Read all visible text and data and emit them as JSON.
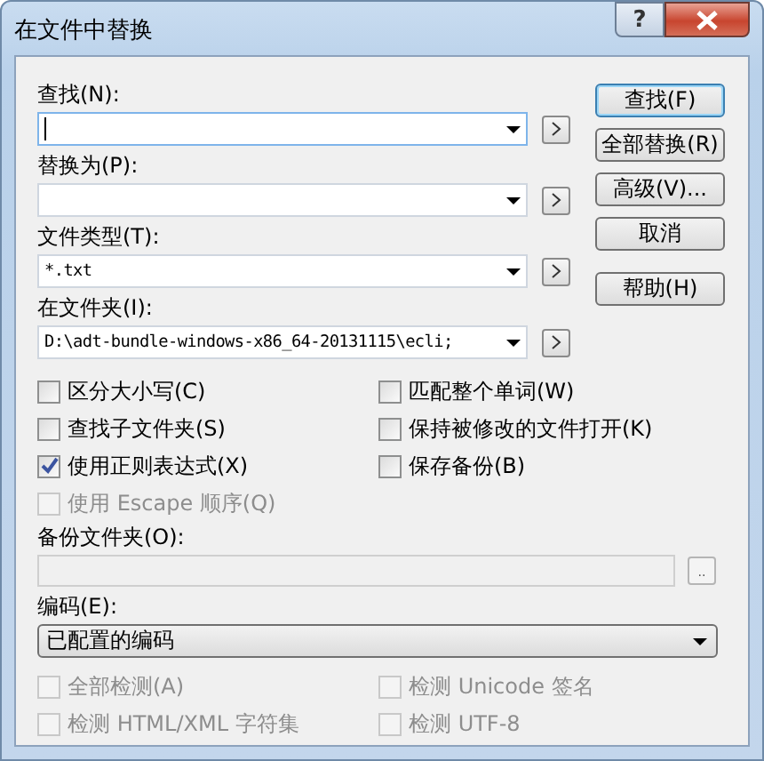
{
  "window": {
    "title": "在文件中替换",
    "help": "?"
  },
  "fields": [
    {
      "label": "查找(N):",
      "focused": true,
      "arrow_button": true
    },
    {
      "label": "替换为(P):",
      "focused": false,
      "arrow_button": true
    },
    {
      "label": "文件类型(T):",
      "value": "*.txt",
      "focused": false,
      "arrow_button": true
    },
    {
      "label": "在文件夹(I):",
      "value": "D:\\adt-bundle-windows-x86_64-20131115\\ecli;",
      "focused": false,
      "arrow_button": true
    }
  ],
  "buttons": [
    {
      "label": "查找(F)",
      "default": true
    },
    {
      "label": "全部替换(R)",
      "default": false
    },
    {
      "label": "高级(V)...",
      "default": false
    },
    {
      "label": "取消",
      "default": false
    },
    {
      "label": "帮助(H)",
      "default": false
    }
  ],
  "options": [
    {
      "label": "区分大小写(C)",
      "checked": false,
      "disabled": false
    },
    {
      "label": "匹配整个单词(W)",
      "checked": false,
      "disabled": false
    },
    {
      "label": "查找子文件夹(S)",
      "checked": false,
      "disabled": false
    },
    {
      "label": "保持被修改的文件打开(K)",
      "checked": false,
      "disabled": false
    },
    {
      "label": "使用正则表达式(X)",
      "checked": true,
      "disabled": false
    },
    {
      "label": "保存备份(B)",
      "checked": false,
      "disabled": false
    },
    {
      "label": "使用 Escape 顺序(Q)",
      "checked": false,
      "disabled": true
    }
  ],
  "backup_folder": {
    "label": "备份文件夹(O):",
    "disabled": true,
    "browse": ".."
  },
  "encoding": {
    "label": "编码(E):",
    "value": "已配置的编码"
  },
  "detect_options": [
    {
      "label": "全部检测(A)",
      "checked": false,
      "disabled": true
    },
    {
      "label": "检测 Unicode 签名",
      "checked": false,
      "disabled": true
    },
    {
      "label": "检测 HTML/XML 字符集",
      "checked": false,
      "disabled": true
    },
    {
      "label": "检测 UTF-8",
      "checked": false,
      "disabled": true
    }
  ]
}
